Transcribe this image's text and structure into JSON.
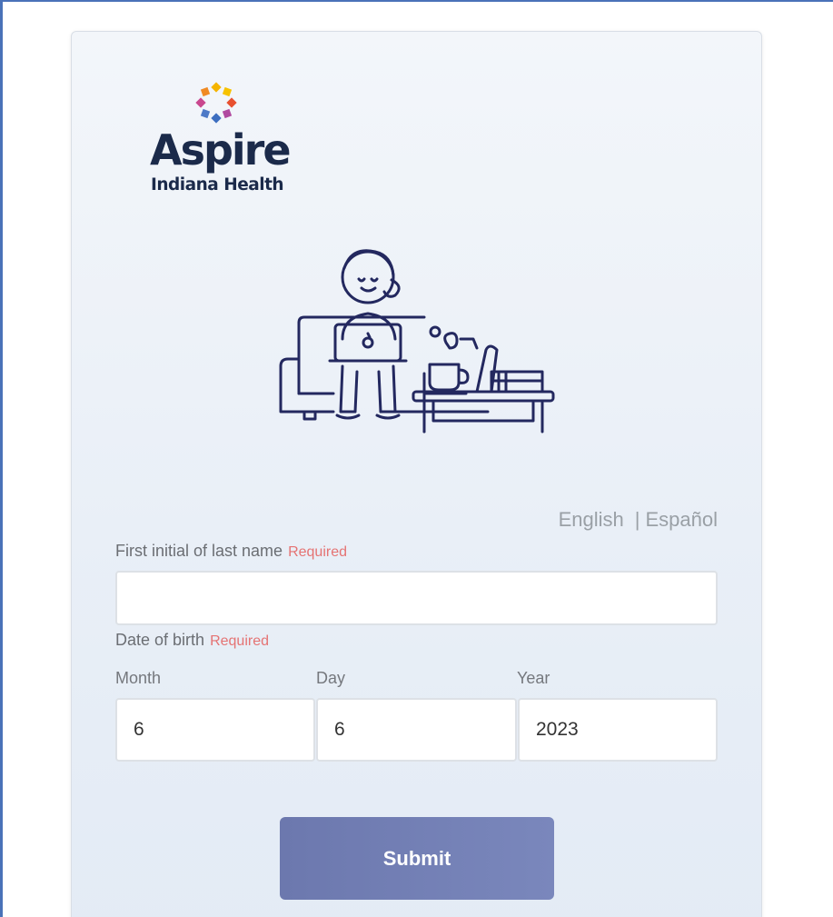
{
  "brand": {
    "name": "Aspire",
    "subtitle": "Indiana Health",
    "logo_colors": [
      "#f5b400",
      "#f08a24",
      "#e8502f",
      "#c9478e",
      "#8c5fbf",
      "#4e7ac7"
    ]
  },
  "language": {
    "english": "English",
    "separator": "|",
    "spanish": "Español"
  },
  "form": {
    "last_initial": {
      "label": "First initial of last name",
      "required": "Required",
      "value": ""
    },
    "dob": {
      "label": "Date of birth",
      "required": "Required",
      "month_label": "Month",
      "month_value": "6",
      "day_label": "Day",
      "day_value": "6",
      "year_label": "Year",
      "year_value": "2023"
    },
    "submit_label": "Submit"
  },
  "colors": {
    "brand_navy": "#1b2a4a",
    "illustration_stroke": "#23285f",
    "required_red": "#e57373",
    "submit_button": "#7280b5"
  }
}
